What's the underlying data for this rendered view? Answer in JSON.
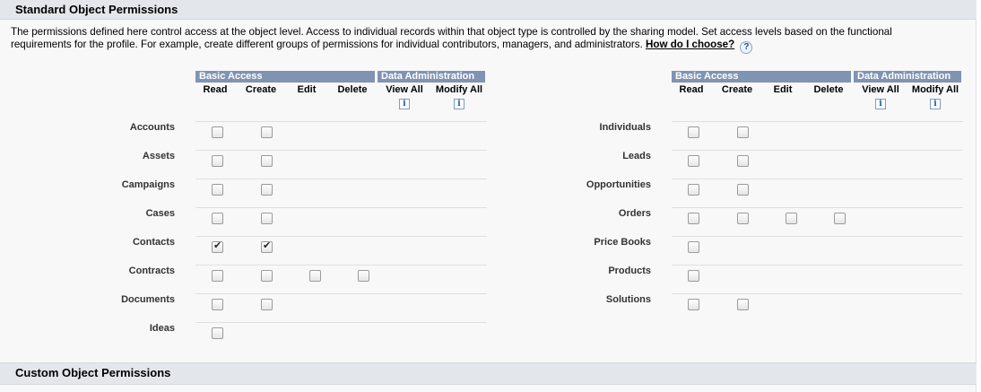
{
  "standard_title": "Standard Object Permissions",
  "intro_text": "The permissions defined here control access at the object level. Access to individual records within that object type is controlled by the sharing model. Set access levels based on the functional requirements for the profile. For example, create different groups of permissions for individual contributors, managers, and administrators.",
  "help_link": "How do I choose?",
  "help_icon": "?",
  "info_icon": "i",
  "groups": {
    "basic": "Basic Access",
    "admin": "Data Administration"
  },
  "columns": [
    "Read",
    "Create",
    "Edit",
    "Delete",
    "View All",
    "Modify All"
  ],
  "left_table": [
    {
      "label": "Accounts",
      "boxes": [
        false,
        false,
        null,
        null
      ]
    },
    {
      "label": "Assets",
      "boxes": [
        false,
        false,
        null,
        null
      ]
    },
    {
      "label": "Campaigns",
      "boxes": [
        false,
        false,
        null,
        null
      ]
    },
    {
      "label": "Cases",
      "boxes": [
        false,
        false,
        null,
        null
      ]
    },
    {
      "label": "Contacts",
      "boxes": [
        true,
        true,
        null,
        null
      ]
    },
    {
      "label": "Contracts",
      "boxes": [
        false,
        false,
        false,
        false
      ]
    },
    {
      "label": "Documents",
      "boxes": [
        false,
        false,
        null,
        null
      ]
    },
    {
      "label": "Ideas",
      "boxes": [
        false,
        null,
        null,
        null
      ]
    }
  ],
  "right_table": [
    {
      "label": "Individuals",
      "boxes": [
        false,
        false,
        null,
        null
      ]
    },
    {
      "label": "Leads",
      "boxes": [
        false,
        false,
        null,
        null
      ]
    },
    {
      "label": "Opportunities",
      "boxes": [
        false,
        false,
        null,
        null
      ]
    },
    {
      "label": "Orders",
      "boxes": [
        false,
        false,
        false,
        false
      ]
    },
    {
      "label": "Price Books",
      "boxes": [
        false,
        null,
        null,
        null
      ]
    },
    {
      "label": "Products",
      "boxes": [
        false,
        null,
        null,
        null
      ]
    },
    {
      "label": "Solutions",
      "boxes": [
        false,
        false,
        null,
        null
      ]
    }
  ],
  "custom_title": "Custom Object Permissions",
  "colors": {
    "group_bar": "#8193b3",
    "section_header": "#e3e7ec"
  }
}
